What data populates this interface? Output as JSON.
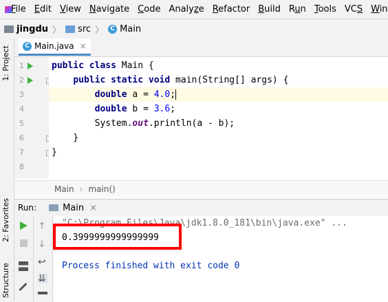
{
  "menu": [
    "File",
    "Edit",
    "View",
    "Navigate",
    "Code",
    "Analyze",
    "Refactor",
    "Build",
    "Run",
    "Tools",
    "VCS",
    "Window"
  ],
  "menu_mnemonics": [
    "F",
    "E",
    "V",
    "N",
    "C",
    "z",
    "R",
    "B",
    "u",
    "T",
    "S",
    "W"
  ],
  "breadcrumb": {
    "project": "jingdu",
    "folder": "src",
    "file": "Main"
  },
  "left_tabs": {
    "project": "1: Project",
    "favorites": "2: Favorites",
    "structure": "Structure"
  },
  "editor_tab": {
    "label": "Main.java"
  },
  "code": {
    "line_numbers": [
      "1",
      "2",
      "3",
      "4",
      "5",
      "6",
      "7",
      "8"
    ],
    "l1": {
      "kw1": "public",
      "kw2": "class",
      "rest": " Main {"
    },
    "l2": {
      "indent": "    ",
      "kw1": "public",
      "kw2": "static",
      "kw3": "void",
      "rest": " main(String[] args) {"
    },
    "l3": {
      "indent": "        ",
      "kw": "double",
      "mid": " a = ",
      "num": "4.0",
      "end": ";"
    },
    "l4": {
      "indent": "        ",
      "kw": "double",
      "mid": " b = ",
      "num": "3.6",
      "end": ";"
    },
    "l5": {
      "indent": "        ",
      "pre": "System.",
      "field": "out",
      "post": ".println(a - b);"
    },
    "l6": {
      "text": "    }"
    },
    "l7": {
      "text": "}"
    }
  },
  "editor_breadcrumb": {
    "class": "Main",
    "method": "main()"
  },
  "run": {
    "title": "Run:",
    "tab": "Main",
    "console": {
      "command": "\"C:\\Program Files\\Java\\jdk1.8.0_181\\bin\\java.exe\" ...",
      "output": "0.3999999999999999",
      "finished": "Process finished with exit code 0"
    }
  },
  "colors": {
    "keyword": "#000080",
    "number": "#0000ff",
    "highlight_box": "#ff0000",
    "run_arrow": "#3bb33b"
  }
}
